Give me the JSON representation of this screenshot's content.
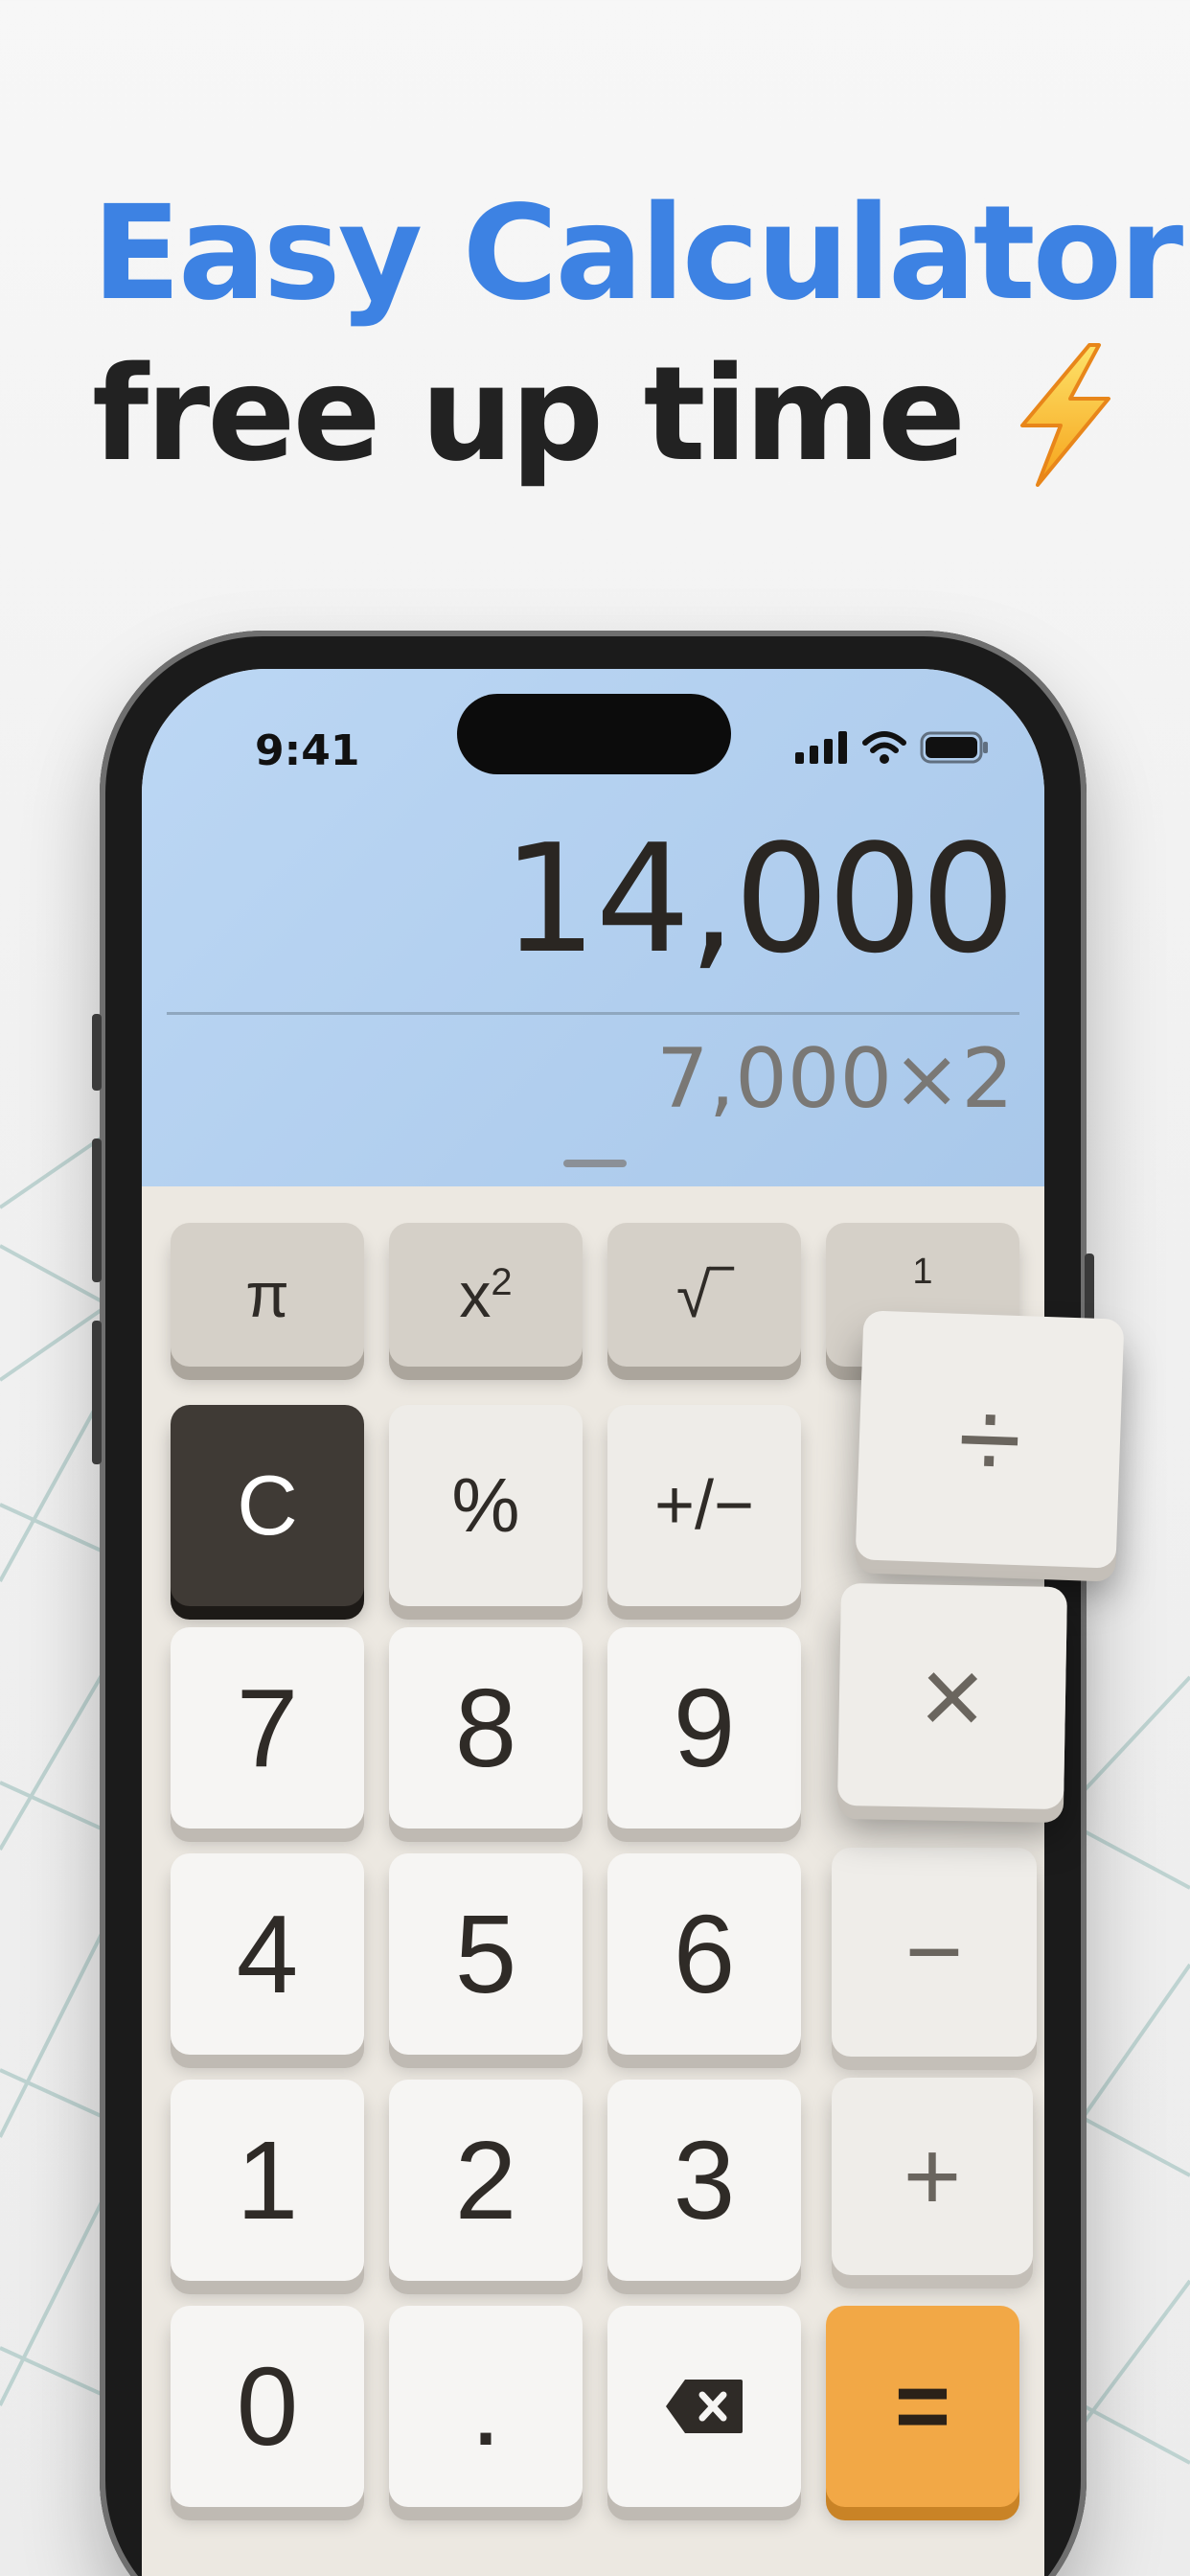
{
  "headline": {
    "title": "Easy Calculator",
    "subtitle": "free up time"
  },
  "status_bar": {
    "time": "9:41"
  },
  "display": {
    "result": "14,000",
    "expression": "7,000×2"
  },
  "keys": {
    "pi": "π",
    "square_base": "x",
    "square_exp": "2",
    "sqrt": "√‾",
    "reciprocal_num": "1",
    "clear": "C",
    "percent": "%",
    "plus_minus": "+/−",
    "divide": "÷",
    "seven": "7",
    "eight": "8",
    "nine": "9",
    "multiply": "×",
    "four": "4",
    "five": "5",
    "six": "6",
    "minus": "−",
    "one": "1",
    "two": "2",
    "three": "3",
    "plus": "+",
    "zero": "0",
    "decimal": ".",
    "equals": "="
  },
  "icons": {
    "headline_icon": "lightning-bolt-icon",
    "backspace": "backspace-icon",
    "signal": "cellular-signal-icon",
    "wifi": "wifi-icon",
    "battery": "battery-icon"
  },
  "colors": {
    "brand_blue": "#3d82e3",
    "equals_orange": "#f2a846",
    "clear_dark": "#3f3a35",
    "display_blue": "#b7d3f1"
  }
}
